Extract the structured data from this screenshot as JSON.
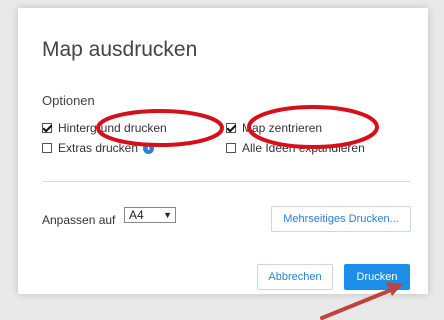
{
  "dialog": {
    "title": "Map ausdrucken",
    "section_label": "Optionen",
    "options": [
      {
        "label": "Hintergrund drucken",
        "checked": true
      },
      {
        "label": "Map zentrieren",
        "checked": true
      },
      {
        "label": "Extras drucken",
        "checked": false,
        "info_icon": "info-icon"
      },
      {
        "label": "Alle Ideen expandieren",
        "checked": false
      }
    ],
    "fit_label": "Anpassen auf",
    "paper_size": "A4",
    "multipage_button": "Mehrseitiges Drucken...",
    "cancel_button": "Abbrechen",
    "print_button": "Drucken",
    "info_glyph": "i"
  },
  "colors": {
    "accent": "#1b8fe8",
    "annotation": "#d6101a",
    "arrow": "#c0443b"
  }
}
